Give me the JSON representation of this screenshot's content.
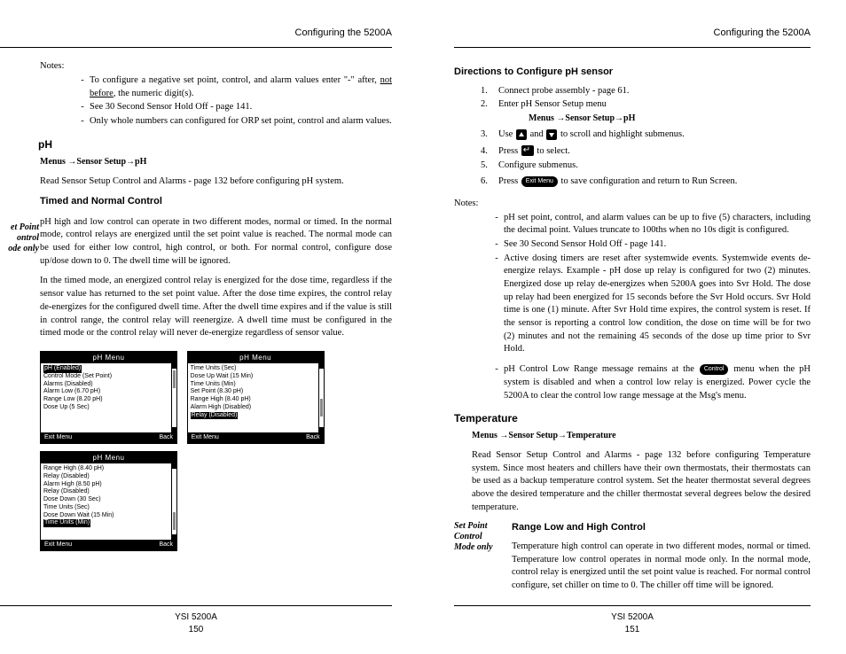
{
  "header": {
    "title": "Configuring the 5200A"
  },
  "footer": {
    "model": "YSI 5200A",
    "page_left": "150",
    "page_right": "151"
  },
  "left": {
    "notes_label": "Notes:",
    "notes": [
      {
        "pre": "To configure a negative set point, control, and alarm values enter \"-\" after, ",
        "under": "not before",
        "post": ", the numeric digit(s)."
      },
      {
        "text": "See 30 Second Sensor Hold Off - page 141."
      },
      {
        "text": "Only whole numbers can configured for ORP set point, control and alarm values."
      }
    ],
    "sec_ph": "pH",
    "ph_menu": "Menus →Sensor Setup→pH",
    "ph_read": "Read  Sensor Setup Control and Alarms - page 132 before configuring  pH system.",
    "sidenote": "et Point ontrol ode only",
    "sec_timed": "Timed and Normal Control",
    "p1": "pH high and low control can operate in two different modes, normal or timed.  In the normal mode, control relays are energized until the set point value is reached.  The normal mode can be used for either low control, high control, or both. For normal control, configure dose up/dose down to 0.  The dwell time will be ignored.",
    "p2": "In the timed mode, an energized control relay is energized for the dose time, regardless if the sensor value has returned to the set point value.  After the dose time expires, the control relay de-energizes for the configured dwell time.  After the dwell time expires and if the value is still in control range, the control relay will reenergize. A dwell time must be configured in the timed mode or the control relay will never de-energize regardless of sensor value.",
    "screens": {
      "title": "pH Menu",
      "exit": "Exit Menu",
      "back": "Back",
      "s1": [
        "pH (Enabled)",
        "Control Mode (Set Point)",
        "Alarms (Disabled)",
        "Alarm Low (6.70 pH)",
        "Range Low (8.20 pH)",
        "Dose Up (5 Sec)"
      ],
      "s1_hl": 0,
      "s2": [
        "Time Units (Sec)",
        "Dose Up Wait (15 Min)",
        "Time Units (Min)",
        "Set Point (8.30 pH)",
        "Range High (8.40 pH)",
        "Alarm High (Disabled)",
        "Relay (Disabled)"
      ],
      "s2_hl": 6,
      "s3": [
        "Range High (8.40 pH)",
        "Relay (Disabled)",
        "Alarm High (8.50 pH)",
        "Relay (Disabled)",
        "Dose Down (30 Sec)",
        "Time Units (Sec)",
        "Dose Down Wait (15 Min)",
        "Time Units (Min)"
      ],
      "s3_hl": 7
    }
  },
  "right": {
    "sec_dir": "Directions to Configure pH sensor",
    "steps": {
      "s1": "Connect probe assembly - page 61.",
      "s2": "Enter pH Sensor Setup menu",
      "s2_menu": "Menus →Sensor Setup→pH",
      "s3a": "Use ",
      "s3b": " and ",
      "s3c": " to scroll and highlight submenus.",
      "s4a": "Press ",
      "s4b": " to select.",
      "s5": "Configure submenus.",
      "s6a": "Press ",
      "s6b": " to save configuration and return to Run Screen.",
      "exit_pill": "Exit Menu"
    },
    "notes_label": "Notes:",
    "notes": [
      "pH set point, control, and alarm values can be up to five (5) characters, including the decimal point.  Values truncate to 100ths when no 10s digit is configured.",
      "See 30 Second Sensor Hold Off - page 141.",
      "Active dosing timers are reset after systemwide events.  Systemwide events de-energize relays.  Example - pH dose up relay is configured for two (2) minutes.  Energized dose up relay de-energizes when 5200A goes into Svr Hold.  The dose up relay had been energized for 15 seconds before the Svr Hold occurs.  Svr Hold time is one (1) minute.  After Svr Hold time expires, the control system is reset.  If the sensor is reporting a control low condition, the dose on time will be for two (2) minutes and not the remaining 45 seconds of the dose up time prior to Svr Hold."
    ],
    "note_ctrl_a": "pH Control Low Range message remains at the ",
    "note_ctrl_pill": "Control",
    "note_ctrl_b": " menu when the pH system is disabled and when a control low relay is energized.  Power cycle the 5200A to clear the control low range message at the Msg's menu.",
    "sec_temp": "Temperature",
    "temp_menu": "Menus →Sensor Setup→Temperature",
    "temp_p": "Read Sensor Setup Control and Alarms - page 132 before configuring Temperature system.  Since most heaters and chillers have their own thermostats, their thermostats can be used as a backup temperature control system.  Set the heater thermostat several degrees above the desired temperature and the chiller thermostat several degrees below the desired temperature.",
    "sidenote": [
      "Set Point",
      "Control",
      "Mode only"
    ],
    "sec_range": "Range Low and High Control",
    "range_p": "Temperature high control can operate in two different modes, normal or timed. Temperature low control operates in normal mode only.  In the normal mode, control relay is energized until the set point value is reached. For normal control configure, set chiller on time to 0.  The chiller off time will be ignored."
  }
}
